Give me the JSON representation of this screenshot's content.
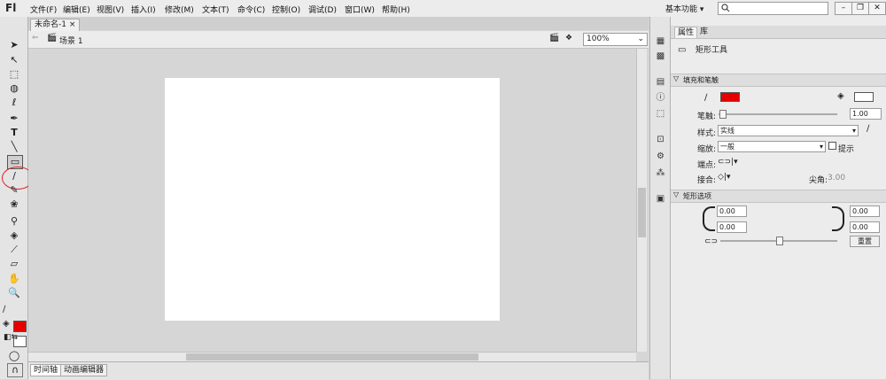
{
  "app": {
    "logo": "Fl"
  },
  "menubar": {
    "items": [
      "文件(F)",
      "编辑(E)",
      "视图(V)",
      "插入(I)",
      "修改(M)",
      "文本(T)",
      "命令(C)",
      "控制(O)",
      "调试(D)",
      "窗口(W)",
      "帮助(H)"
    ],
    "workspace": "基本功能 ▾"
  },
  "document": {
    "tab_title": "未命名-1",
    "tab_close": "×",
    "scene": "场景 1",
    "zoom": "100%"
  },
  "timeline": {
    "tabs": [
      "时间轴",
      "动画编辑器"
    ]
  },
  "colors": {
    "stroke": "#e60000",
    "fill": "#ffffff",
    "highlight_circle": "#e02020"
  },
  "properties": {
    "tabs": [
      "属性",
      "库"
    ],
    "tool_name": "矩形工具",
    "fill_stroke_header": "填充和笔触",
    "stroke_label": "笔触:",
    "stroke_value": "1.00",
    "style_label": "样式:",
    "style_value": "实线",
    "scale_label": "缩放:",
    "scale_value": "一般",
    "hint_label": "提示",
    "cap_label": "端点:",
    "join_label": "接合:",
    "miter_label": "尖角:",
    "miter_value": "3.00",
    "rect_header": "矩形选项",
    "corners": [
      "0.00",
      "0.00",
      "0.00",
      "0.00"
    ],
    "reset_label": "重置"
  },
  "icons": {
    "tools": [
      "selection-icon",
      "subselection-icon",
      "free-transform-icon",
      "3d-rotation-icon",
      "lasso-icon",
      "pen-icon",
      "text-icon",
      "line-icon",
      "rectangle-icon",
      "pencil-icon",
      "brush-icon",
      "deco-icon",
      "bone-icon",
      "paint-bucket-icon",
      "eyedropper-icon",
      "eraser-icon",
      "hand-icon",
      "zoom-icon"
    ]
  }
}
